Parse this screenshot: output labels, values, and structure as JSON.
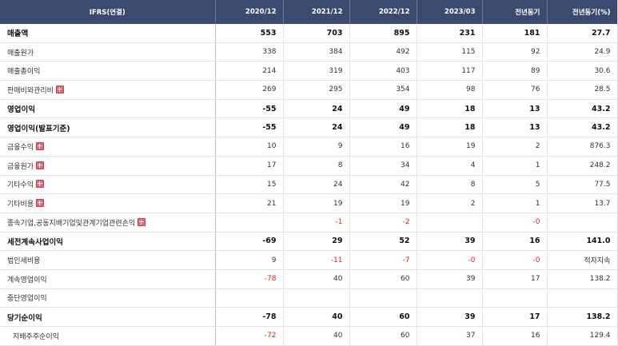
{
  "header": [
    "IFRS(연결)",
    "2020/12",
    "2021/12",
    "2022/12",
    "2023/03",
    "전년동기",
    "전년동기(%)"
  ],
  "rows": [
    {
      "label": "매출액",
      "bold": true,
      "plus": false,
      "sub": false,
      "values": [
        "553",
        "703",
        "895",
        "231",
        "181",
        "27.7"
      ]
    },
    {
      "label": "매출원가",
      "bold": false,
      "plus": false,
      "sub": false,
      "values": [
        "338",
        "384",
        "492",
        "115",
        "92",
        "24.9"
      ]
    },
    {
      "label": "매출총이익",
      "bold": false,
      "plus": false,
      "sub": false,
      "values": [
        "214",
        "319",
        "403",
        "117",
        "89",
        "30.6"
      ]
    },
    {
      "label": "판매비와관리비",
      "bold": false,
      "plus": true,
      "sub": false,
      "values": [
        "269",
        "295",
        "354",
        "98",
        "76",
        "28.5"
      ]
    },
    {
      "label": "영업이익",
      "bold": true,
      "plus": false,
      "sub": false,
      "values": [
        "-55",
        "24",
        "49",
        "18",
        "13",
        "43.2"
      ]
    },
    {
      "label": "영업이익(발표기준)",
      "bold": true,
      "plus": false,
      "sub": false,
      "values": [
        "-55",
        "24",
        "49",
        "18",
        "13",
        "43.2"
      ]
    },
    {
      "label": "금융수익",
      "bold": false,
      "plus": true,
      "sub": false,
      "values": [
        "10",
        "9",
        "16",
        "19",
        "2",
        "876.3"
      ]
    },
    {
      "label": "금융원가",
      "bold": false,
      "plus": true,
      "sub": false,
      "values": [
        "17",
        "8",
        "34",
        "4",
        "1",
        "248.2"
      ]
    },
    {
      "label": "기타수익",
      "bold": false,
      "plus": true,
      "sub": false,
      "values": [
        "15",
        "24",
        "42",
        "8",
        "5",
        "77.5"
      ]
    },
    {
      "label": "기타비용",
      "bold": false,
      "plus": true,
      "sub": false,
      "values": [
        "21",
        "19",
        "19",
        "2",
        "1",
        "13.7"
      ]
    },
    {
      "label": "종속기업,공동지배기업및관계기업관련손익",
      "bold": false,
      "plus": true,
      "sub": false,
      "values": [
        "",
        "-1",
        "-2",
        "",
        "-0",
        ""
      ]
    },
    {
      "label": "세전계속사업이익",
      "bold": true,
      "plus": false,
      "sub": false,
      "values": [
        "-69",
        "29",
        "52",
        "39",
        "16",
        "141.0"
      ]
    },
    {
      "label": "법인세비용",
      "bold": false,
      "plus": false,
      "sub": false,
      "values": [
        "9",
        "-11",
        "-7",
        "-0",
        "-0",
        "적자지속"
      ]
    },
    {
      "label": "계속영업이익",
      "bold": false,
      "plus": false,
      "sub": false,
      "values": [
        "-78",
        "40",
        "60",
        "39",
        "17",
        "138.2"
      ]
    },
    {
      "label": "중단영업이익",
      "bold": false,
      "plus": false,
      "sub": false,
      "values": [
        "",
        "",
        "",
        "",
        "",
        ""
      ]
    },
    {
      "label": "당기순이익",
      "bold": true,
      "plus": false,
      "sub": false,
      "values": [
        "-78",
        "40",
        "60",
        "39",
        "17",
        "138.2"
      ]
    },
    {
      "label": "지배주주순이익",
      "bold": false,
      "plus": false,
      "sub": true,
      "values": [
        "-72",
        "40",
        "60",
        "37",
        "16",
        "129.4"
      ]
    }
  ]
}
